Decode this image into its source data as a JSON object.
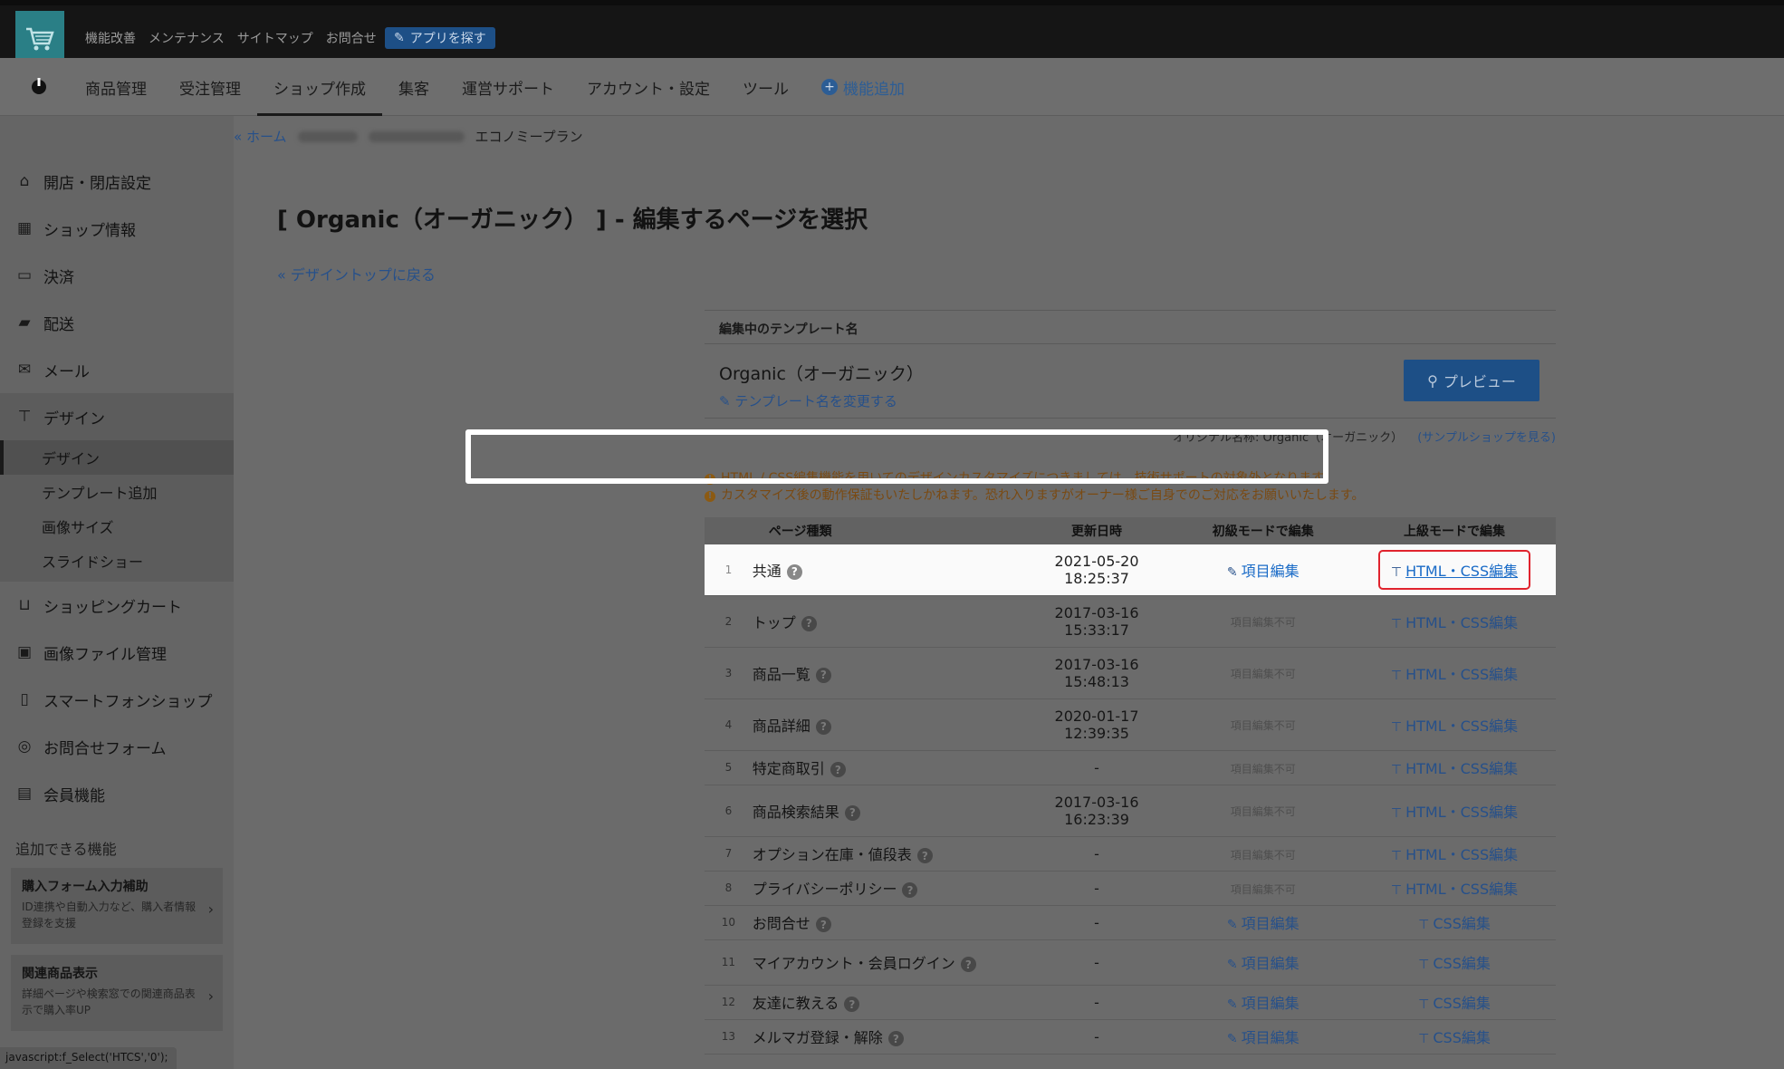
{
  "topbar": {
    "links": [
      "機能改善",
      "メンテナンス",
      "サイトマップ",
      "お問合せ"
    ],
    "app_button": "アプリを探す"
  },
  "nav": {
    "items": [
      "商品管理",
      "受注管理",
      "ショップ作成",
      "集客",
      "運営サポート",
      "アカウント・設定",
      "ツール"
    ],
    "active_index": 2,
    "add_label": "機能追加"
  },
  "sidebar": {
    "items_top": [
      "開店・閉店設定",
      "ショップ情報",
      "決済",
      "配送",
      "メール",
      "デザイン"
    ],
    "design_sub": [
      "デザイン",
      "テンプレート追加",
      "画像サイズ",
      "スライドショー"
    ],
    "items_bottom": [
      "ショッピングカート",
      "画像ファイル管理",
      "スマートフォンショップ",
      "お問合せフォーム",
      "会員機能"
    ],
    "section_title": "追加できる機能",
    "promos": [
      {
        "title": "購入フォーム入力補助",
        "desc": "ID連携や自動入力など、購入者情報登録を支援"
      },
      {
        "title": "関連商品表示",
        "desc": "詳細ページや検索窓での関連商品表示で購入率UP"
      }
    ],
    "status": "javascript:f_Select('HTCS','0');"
  },
  "breadcrumb": {
    "home": "« ホーム",
    "plan": "エコノミープラン"
  },
  "main": {
    "title": "[ Organic（オーガニック） ] - 編集するページを選択",
    "back": "« デザイントップに戻る",
    "tpl_header": "編集中のテンプレート名",
    "tpl_name": "Organic（オーガニック）",
    "rename": "テンプレート名を変更する",
    "preview": "プレビュー",
    "original": "オリジナル名称: Organic（オーガニック）",
    "sample": "(サンプルショップを見る)",
    "warnings": [
      "HTML / CSS編集機能を用いてのデザインカスタマイズにつきましては、技術サポートの対象外となります。",
      "カスタマイズ後の動作保証もいたしかねます。恐れ入りますがオーナー様ご自身でのご対応をお願いいたします。"
    ]
  },
  "table": {
    "headers": [
      "ページ種類",
      "更新日時",
      "初級モードで編集",
      "上級モードで編集"
    ],
    "rows": [
      {
        "num": "1",
        "page": "共通",
        "date": "2021-05-20",
        "time": "18:25:37",
        "basic": "項目編集",
        "adv": "HTML・CSS編集"
      },
      {
        "num": "2",
        "page": "トップ",
        "date": "2017-03-16",
        "time": "15:33:17",
        "basic": "項目編集不可",
        "adv": "HTML・CSS編集"
      },
      {
        "num": "3",
        "page": "商品一覧",
        "date": "2017-03-16",
        "time": "15:48:13",
        "basic": "項目編集不可",
        "adv": "HTML・CSS編集"
      },
      {
        "num": "4",
        "page": "商品詳細",
        "date": "2020-01-17",
        "time": "12:39:35",
        "basic": "項目編集不可",
        "adv": "HTML・CSS編集"
      },
      {
        "num": "5",
        "page": "特定商取引",
        "date": "-",
        "time": "",
        "basic": "項目編集不可",
        "adv": "HTML・CSS編集"
      },
      {
        "num": "6",
        "page": "商品検索結果",
        "date": "2017-03-16",
        "time": "16:23:39",
        "basic": "項目編集不可",
        "adv": "HTML・CSS編集"
      },
      {
        "num": "7",
        "page": "オプション在庫・値段表",
        "date": "-",
        "time": "",
        "basic": "項目編集不可",
        "adv": "HTML・CSS編集"
      },
      {
        "num": "8",
        "page": "プライバシーポリシー",
        "date": "-",
        "time": "",
        "basic": "項目編集不可",
        "adv": "HTML・CSS編集"
      },
      {
        "num": "10",
        "page": "お問合せ",
        "date": "-",
        "time": "",
        "basic": "項目編集",
        "adv": "CSS編集"
      },
      {
        "num": "11",
        "page": "マイアカウント・会員ログイン",
        "date": "-",
        "time": "",
        "basic": "項目編集",
        "adv": "CSS編集"
      },
      {
        "num": "12",
        "page": "友達に教える",
        "date": "-",
        "time": "",
        "basic": "項目編集",
        "adv": "CSS編集"
      },
      {
        "num": "13",
        "page": "メルマガ登録・解除",
        "date": "-",
        "time": "",
        "basic": "項目編集",
        "adv": "CSS編集"
      }
    ]
  }
}
